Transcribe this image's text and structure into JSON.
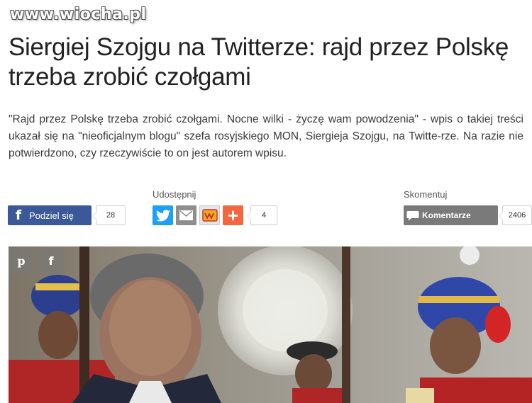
{
  "watermark": "www.wiocha.pl",
  "article": {
    "title": "Siergiej Szojgu na Twitterze: rajd przez Polskę trzeba zrobić czołgami",
    "lead": "\"Rajd przez Polskę trzeba zrobić czołgami. Nocne wilki - życzę wam powodzenia\" - wpis o takiej treści ukazał się na \"nieoficjalnym blogu\" szefa rosyjskiego MON, Siergieja Szojgu, na Twitte-rze. Na razie nie potwierdzono, czy rzeczywiście to on jest autorem wpisu."
  },
  "share": {
    "facebook_label": "Podziel się",
    "facebook_count": "28",
    "share_heading": "Udostępnij",
    "share_count": "4",
    "comment_heading": "Skomentuj",
    "comments_label": "Komentarze",
    "comments_count": "2406"
  },
  "photo_overlay": {
    "pinterest_glyph": "p",
    "facebook_glyph": "f"
  },
  "colors": {
    "facebook": "#3b5998",
    "twitter": "#1da1f2",
    "mail": "#8e8e8e",
    "plus": "#f26641",
    "comments": "#7a7a7a"
  },
  "icons": [
    "facebook-icon",
    "twitter-icon",
    "mail-icon",
    "wykop-icon",
    "plus-icon",
    "comment-bubble-icon",
    "pinterest-icon"
  ]
}
